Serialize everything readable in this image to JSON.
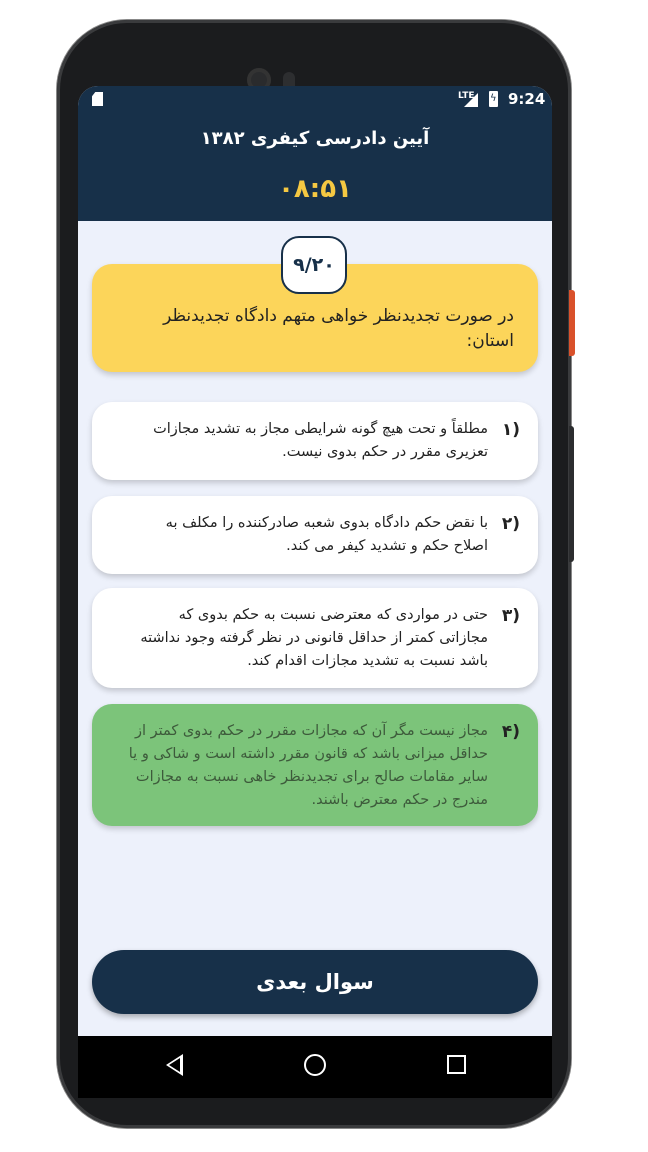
{
  "status_bar": {
    "network": "LTE",
    "time": "9:24"
  },
  "header": {
    "title": "آیین دادرسی کیفری ۱۳۸۲",
    "timer": "۰۸:۵۱"
  },
  "question": {
    "counter": "۹/۲۰",
    "text": "در صورت تجدیدنظر خواهی متهم دادگاه تجدیدنظر استان:"
  },
  "options": [
    {
      "number": "(۱",
      "text": "مطلقاً و تحت هیچ گونه شرایطی مجاز به تشدید مجازات تعزیری مقرر در حکم بدوی نیست.",
      "state": "normal"
    },
    {
      "number": "(۲",
      "text": "با نقض حکم دادگاه بدوی شعبه صادرکننده را مکلف به اصلاح حکم و تشدید کیفر می کند.",
      "state": "normal"
    },
    {
      "number": "(۳",
      "text": "حتی در مواردی که معترضی نسبت به حکم بدوی که مجازاتی کمتر از حداقل قانونی در نظر گرفته وجود نداشته باشد نسبت به تشدید مجازات اقدام کند.",
      "state": "normal"
    },
    {
      "number": "(۴",
      "text": "مجاز نیست مگر آن که مجازات مقرر در حکم بدوی کمتر از حداقل میزانی باشد که قانون مقرر داشته است و شاکی و یا سایر مقامات صالح برای تجدیدنظر خاهی نسبت به مجازات مندرج در حکم معترض باشند.",
      "state": "correct"
    }
  ],
  "next_button": {
    "label": "سوال بعدی"
  },
  "colors": {
    "header": "#173049",
    "question_card": "#fcd55a",
    "correct": "#7cc47a",
    "timer": "#f5c842",
    "background": "#edf1fb"
  },
  "nav_icons": [
    "back-icon",
    "home-icon",
    "recent-apps-icon"
  ]
}
